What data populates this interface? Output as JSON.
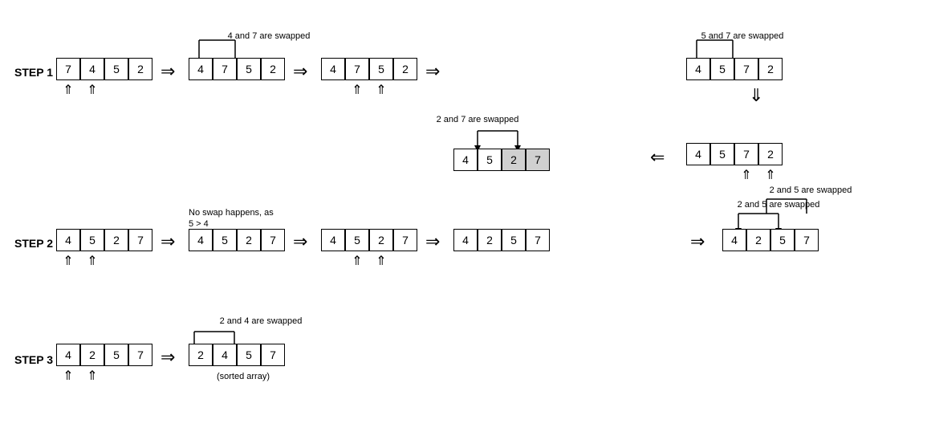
{
  "steps": {
    "step1_label": "STEP 1",
    "step2_label": "STEP 2",
    "step3_label": "STEP 3"
  },
  "annotations": {
    "swap_4_7": "4 and 7 are swapped",
    "swap_5_7_top": "5 and 7 are swapped",
    "swap_2_7": "2 and 7 are swapped",
    "swap_2_5": "2 and 5 are swapped",
    "no_swap": "No swap happens, as\n5 > 4",
    "swap_2_4": "2 and 4 are swapped",
    "sorted": "(sorted array)"
  },
  "arrays": {
    "row1_a": [
      "7",
      "4",
      "5",
      "2"
    ],
    "row1_b": [
      "4",
      "7",
      "5",
      "2"
    ],
    "row1_c": [
      "4",
      "7",
      "5",
      "2"
    ],
    "row1_d": [
      "4",
      "5",
      "7",
      "2"
    ],
    "row2_a": [
      "4",
      "5",
      "7",
      "2"
    ],
    "row2_b": [
      "4",
      "5",
      "2",
      "7"
    ],
    "row3_a": [
      "4",
      "5",
      "2",
      "7"
    ],
    "row3_b": [
      "4",
      "5",
      "2",
      "7"
    ],
    "row3_c": [
      "4",
      "5",
      "2",
      "7"
    ],
    "row3_d": [
      "4",
      "2",
      "5",
      "7"
    ],
    "row4_a": [
      "4",
      "2",
      "5",
      "7"
    ],
    "row4_b": [
      "2",
      "4",
      "5",
      "7"
    ]
  }
}
